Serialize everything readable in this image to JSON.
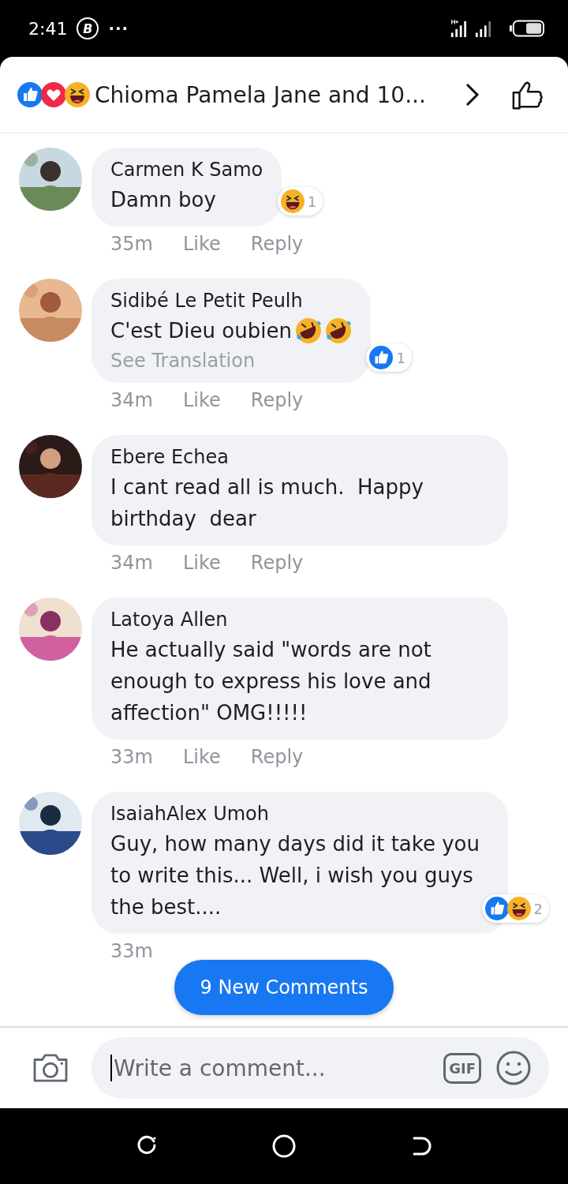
{
  "status_bar": {
    "time": "2:41",
    "badge": "B",
    "more": "···"
  },
  "header": {
    "reactions": [
      {
        "kind": "like"
      },
      {
        "kind": "love"
      },
      {
        "kind": "haha"
      }
    ],
    "title": "Chioma Pamela Jane and 10..."
  },
  "comments": [
    {
      "name": "Carmen K Samo",
      "text": "Damn boy",
      "reactions": [
        {
          "kind": "haha"
        }
      ],
      "reaction_count": "1",
      "time": "35m",
      "actions": [
        "Like",
        "Reply"
      ]
    },
    {
      "name": "Sidibé Le Petit Peulh",
      "text": "C'est Dieu oubien",
      "emojis": [
        {
          "kind": "rofl"
        },
        {
          "kind": "rofl"
        }
      ],
      "translation": "See Translation",
      "reactions": [
        {
          "kind": "like"
        }
      ],
      "reaction_count": "1",
      "time": "34m",
      "actions": [
        "Like",
        "Reply"
      ]
    },
    {
      "name": "Ebere Echea",
      "text": "I cant read all is much.  Happy birthday  dear",
      "time": "34m",
      "actions": [
        "Like",
        "Reply"
      ]
    },
    {
      "name": "Latoya Allen",
      "text": "He actually said \"words are not enough to express his love and affection\" OMG!!!!!",
      "time": "33m",
      "actions": [
        "Like",
        "Reply"
      ]
    },
    {
      "name": "IsaiahAlex Umoh",
      "text": "Guy, how many days did it take you to write this... Well, i wish you guys the best....",
      "reactions": [
        {
          "kind": "like"
        },
        {
          "kind": "haha"
        }
      ],
      "reaction_count": "2",
      "time": "33m"
    }
  ],
  "new_comments_button": "9 New Comments",
  "composer": {
    "placeholder": "Write a comment...",
    "gif": "GIF"
  }
}
